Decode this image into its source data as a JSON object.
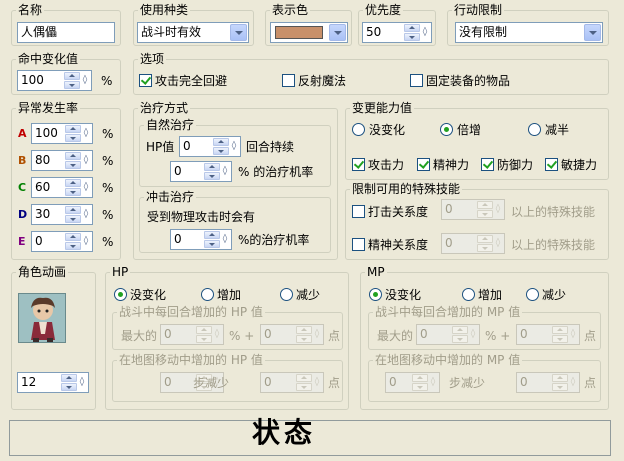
{
  "name_section": {
    "label": "名称",
    "value": "人偶儡"
  },
  "usage_section": {
    "label": "使用种类",
    "value": "战斗时有效"
  },
  "color_section": {
    "label": "表示色",
    "swatch_color": "#c8906a"
  },
  "priority_section": {
    "label": "优先度",
    "value": "50"
  },
  "restriction_section": {
    "label": "行动限制",
    "value": "没有限制"
  },
  "hit_rate": {
    "label": "命中变化值",
    "value": "100",
    "unit": "%"
  },
  "options": {
    "label": "选项",
    "items": [
      {
        "label": "攻击完全回避",
        "checked": true
      },
      {
        "label": "反射魔法",
        "checked": false
      },
      {
        "label": "固定装备的物品",
        "checked": false
      }
    ]
  },
  "abnormal_rate": {
    "label": "异常发生率",
    "unit": "%",
    "rows": [
      {
        "letter": "A",
        "value": "100",
        "color": "#c00000"
      },
      {
        "letter": "B",
        "value": "80",
        "color": "#b05000"
      },
      {
        "letter": "C",
        "value": "60",
        "color": "#008000"
      },
      {
        "letter": "D",
        "value": "30",
        "color": "#000080"
      },
      {
        "letter": "E",
        "value": "0",
        "color": "#800080"
      }
    ]
  },
  "cure_method": {
    "label": "治疗方式",
    "natural": {
      "label": "自然治疗",
      "hp_label": "HP值",
      "hp_value": "0",
      "hp_suffix": "回合持续",
      "rate_value": "0",
      "rate_suffix": "% 的治疗机率"
    },
    "impact": {
      "label": "冲击治疗",
      "desc": "受到物理攻击时会有",
      "rate_value": "0",
      "rate_suffix": "%的治疗机率"
    }
  },
  "ability_change": {
    "label": "变更能力值",
    "radios": [
      {
        "label": "没变化",
        "selected": false
      },
      {
        "label": "倍增",
        "selected": true
      },
      {
        "label": "减半",
        "selected": false
      }
    ],
    "checks": [
      {
        "label": "攻击力",
        "checked": true
      },
      {
        "label": "精神力",
        "checked": true
      },
      {
        "label": "防御力",
        "checked": true
      },
      {
        "label": "敏捷力",
        "checked": true
      }
    ]
  },
  "skill_limit": {
    "label": "限制可用的特殊技能",
    "rows": [
      {
        "label": "打击关系度",
        "value": "0",
        "suffix": "以上的特殊技能"
      },
      {
        "label": "精神关系度",
        "value": "0",
        "suffix": "以上的特殊技能"
      }
    ]
  },
  "animation": {
    "label": "角色动画",
    "value": "12"
  },
  "hp": {
    "label": "HP",
    "radios": [
      {
        "label": "没变化",
        "selected": true
      },
      {
        "label": "增加",
        "selected": false
      },
      {
        "label": "减少",
        "selected": false
      }
    ],
    "battle": {
      "label": "战斗中每回合增加的 HP 值",
      "max_label": "最大的",
      "max_value": "0",
      "mid": "% +",
      "pt_value": "0",
      "pt_suffix": "点"
    },
    "map": {
      "label": "在地图移动中增加的 HP 值",
      "step_value": "0",
      "step_suffix": "步减少",
      "pt_value": "0",
      "pt_suffix": "点"
    }
  },
  "mp": {
    "label": "MP",
    "radios": [
      {
        "label": "没变化",
        "selected": true
      },
      {
        "label": "增加",
        "selected": false
      },
      {
        "label": "减少",
        "selected": false
      }
    ],
    "battle": {
      "label": "战斗中每回合增加的 MP 值",
      "max_label": "最大的",
      "max_value": "0",
      "mid": "% +",
      "pt_value": "0",
      "pt_suffix": "点"
    },
    "map": {
      "label": "在地图移动中增加的 MP 值",
      "step_value": "0",
      "step_suffix": "步减少",
      "pt_value": "0",
      "pt_suffix": "点"
    }
  },
  "status_title": "状态"
}
